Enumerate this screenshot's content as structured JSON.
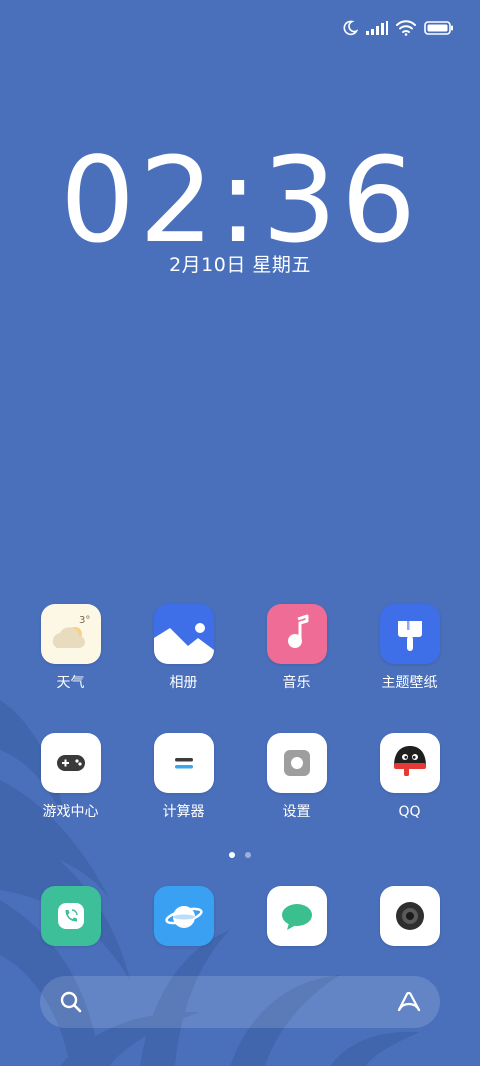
{
  "status_bar": {
    "icons": [
      "moon-icon",
      "signal-icon",
      "wifi-icon",
      "battery-icon"
    ]
  },
  "lockclock": {
    "time": "02:36",
    "date": "2月10日 星期五"
  },
  "home": {
    "row1": [
      {
        "label": "天气",
        "icon": "weather-icon",
        "temp": "3°"
      },
      {
        "label": "相册",
        "icon": "gallery-icon"
      },
      {
        "label": "音乐",
        "icon": "music-icon"
      },
      {
        "label": "主题壁纸",
        "icon": "themes-icon"
      }
    ],
    "row2": [
      {
        "label": "游戏中心",
        "icon": "gamepad-icon"
      },
      {
        "label": "计算器",
        "icon": "calculator-icon"
      },
      {
        "label": "设置",
        "icon": "settings-icon"
      },
      {
        "label": "QQ",
        "icon": "qq-icon"
      }
    ],
    "pages": {
      "count": 2,
      "active": 1
    },
    "dock": [
      {
        "icon": "phone-icon"
      },
      {
        "icon": "browser-icon"
      },
      {
        "icon": "messages-icon"
      },
      {
        "icon": "camera-icon"
      }
    ]
  },
  "search": {
    "left_icon": "search-icon",
    "right_icon": "assistant-icon"
  },
  "colors": {
    "background": "#4a70bc",
    "accent_pink": "#ee6c96",
    "accent_blue": "#3f6fe8",
    "phone_green": "#3dbf9a",
    "message_green": "#3bbf8f"
  }
}
